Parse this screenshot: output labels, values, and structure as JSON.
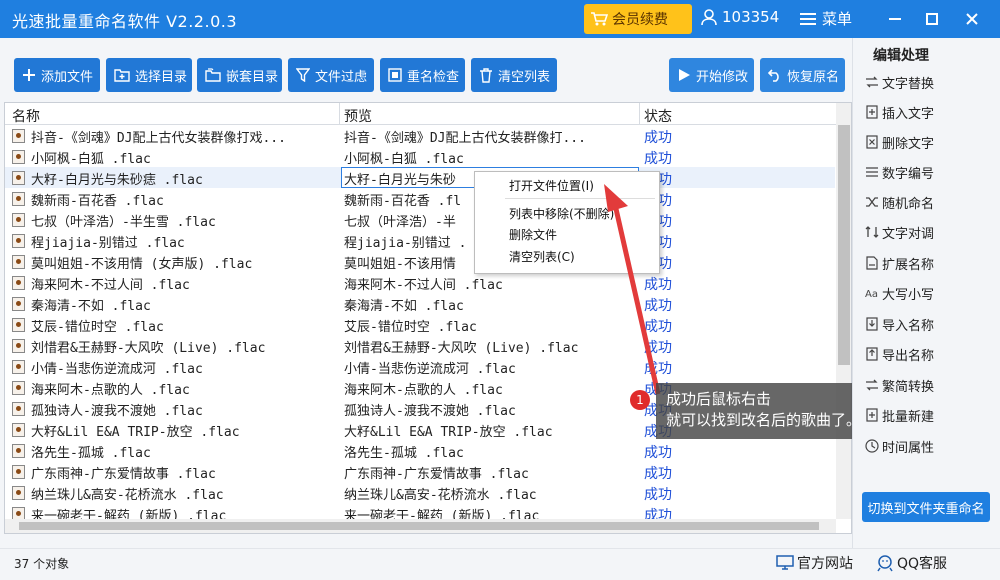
{
  "app": {
    "title": "光速批量重命名软件 V2.2.0.3",
    "vip_label": "会员续费",
    "user_id": "103354",
    "menu_label": "菜单",
    "accent": "#1f7fe0"
  },
  "toolbar": {
    "add_files": "添加文件",
    "select_dir": "选择目录",
    "nested_dir": "嵌套目录",
    "file_filter": "文件过虑",
    "rename_check": "重名检查",
    "clear_list": "清空列表",
    "start": "开始修改",
    "restore": "恢复原名"
  },
  "table": {
    "headers": {
      "name": "名称",
      "preview": "预览",
      "status": "状态"
    },
    "rows": [
      {
        "name": "抖音-《剑魂》DJ配上古代女装群像打戏...",
        "preview": "抖音-《剑魂》DJ配上古代女装群像打...",
        "status": "成功"
      },
      {
        "name": "小阿枫-白狐 .flac",
        "preview": "小阿枫-白狐 .flac",
        "status": "成功"
      },
      {
        "name": "大籽-白月光与朱砂痣 .flac",
        "preview": "大籽-白月光与朱砂",
        "status": "成功"
      },
      {
        "name": "魏新雨-百花香 .flac",
        "preview": "魏新雨-百花香 .fl",
        "status": "成功"
      },
      {
        "name": "七叔（叶泽浩）-半生雪 .flac",
        "preview": "七叔（叶泽浩）-半",
        "status": "成功"
      },
      {
        "name": "程jiajia-别错过 .flac",
        "preview": "程jiajia-别错过 .",
        "status": "成功"
      },
      {
        "name": "莫叫姐姐-不该用情 (女声版) .flac",
        "preview": "莫叫姐姐-不该用情",
        "status": "成功"
      },
      {
        "name": "海来阿木-不过人间 .flac",
        "preview": "海来阿木-不过人间 .flac",
        "status": "成功"
      },
      {
        "name": "秦海清-不如 .flac",
        "preview": "秦海清-不如 .flac",
        "status": "成功"
      },
      {
        "name": "艾辰-错位时空 .flac",
        "preview": "艾辰-错位时空 .flac",
        "status": "成功"
      },
      {
        "name": "刘惜君&王赫野-大风吹 (Live) .flac",
        "preview": "刘惜君&王赫野-大风吹 (Live) .flac",
        "status": "成功"
      },
      {
        "name": "小倩-当悲伤逆流成河 .flac",
        "preview": "小倩-当悲伤逆流成河 .flac",
        "status": "成功"
      },
      {
        "name": "海来阿木-点歌的人 .flac",
        "preview": "海来阿木-点歌的人 .flac",
        "status": "成功"
      },
      {
        "name": "孤独诗人-渡我不渡她 .flac",
        "preview": "孤独诗人-渡我不渡她 .flac",
        "status": "成功"
      },
      {
        "name": "大籽&Lil E&A TRIP-放空 .flac",
        "preview": "大籽&Lil E&A TRIP-放空 .flac",
        "status": "成功"
      },
      {
        "name": "洛先生-孤城 .flac",
        "preview": "洛先生-孤城 .flac",
        "status": "成功"
      },
      {
        "name": "广东雨神-广东爱情故事 .flac",
        "preview": "广东雨神-广东爱情故事 .flac",
        "status": "成功"
      },
      {
        "name": "纳兰珠儿&高安-花桥流水 .flac",
        "preview": "纳兰珠儿&高安-花桥流水 .flac",
        "status": "成功"
      },
      {
        "name": "来一碗老干-解药 (新版) .flac",
        "preview": "来一碗老干-解药 (新版) .flac",
        "status": "成功"
      }
    ]
  },
  "context_menu": {
    "open_location": "打开文件位置(I)",
    "remove_from_list": "列表中移除(不删除)",
    "delete_file": "删除文件",
    "clear_list": "清空列表(C)"
  },
  "tip": {
    "badge": "1",
    "line1": "成功后鼠标右击",
    "line2": "就可以找到改名后的歌曲了。"
  },
  "right_panel": {
    "title": "编辑处理",
    "items": [
      "文字替换",
      "插入文字",
      "删除文字",
      "数字编号",
      "随机命名",
      "文字对调",
      "扩展名称",
      "大写小写",
      "导入名称",
      "导出名称",
      "繁简转换",
      "批量新建",
      "时间属性"
    ],
    "switch_button": "切换到文件夹重命名"
  },
  "status_bar": {
    "object_count": "37 个对象",
    "official_site": "官方网站",
    "qq_service": "QQ客服"
  }
}
